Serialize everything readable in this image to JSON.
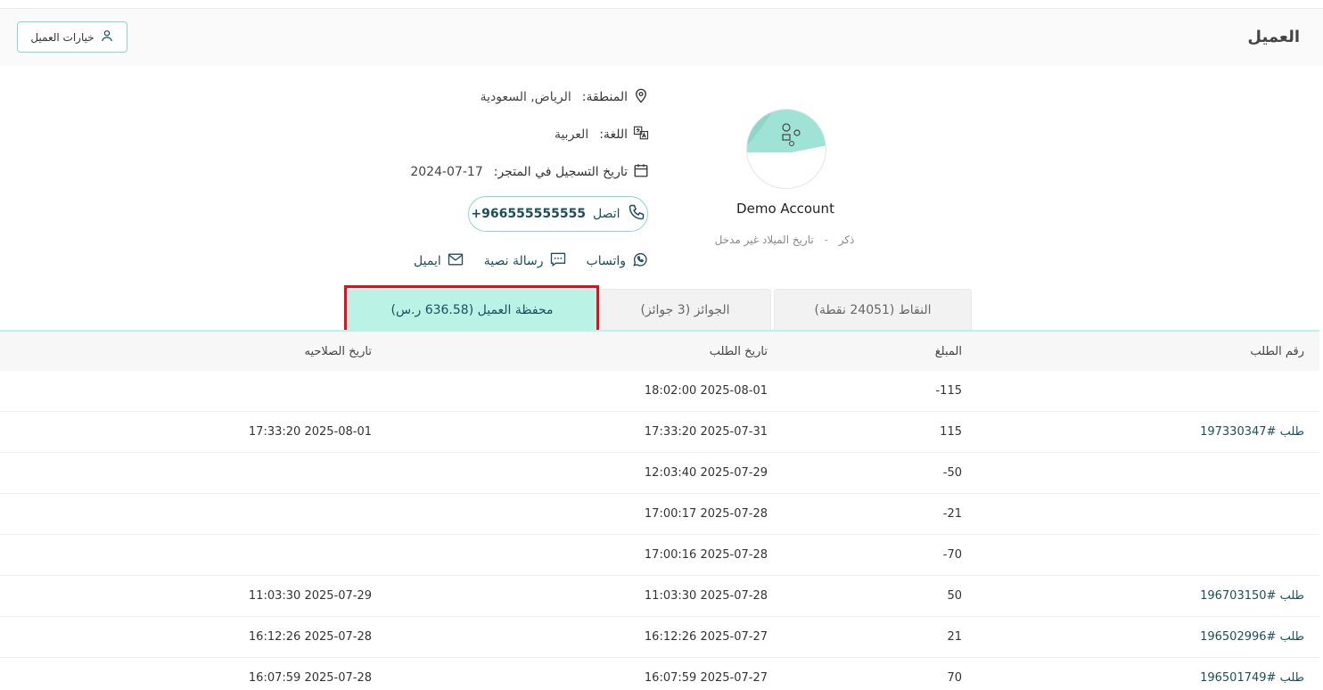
{
  "header": {
    "title": "العميل",
    "options_label": "خيارات العميل"
  },
  "profile": {
    "name": "Demo Account",
    "gender": "ذكر",
    "separator": "-",
    "birthdate": "تاريخ الميلاد غير مدخل"
  },
  "info": {
    "region_label": "المنطقة:",
    "region_value": "الرياض, السعودية",
    "language_label": "اللغة:",
    "language_value": "العربية",
    "registered_label": "تاريخ التسجيل في المتجر:",
    "registered_value": "2024-07-17",
    "call_label": "اتصل",
    "phone": "+966555555555",
    "whatsapp_label": "واتساب",
    "sms_label": "رسالة نصية",
    "email_label": "ايميل"
  },
  "tabs": [
    {
      "label": "النقاط (24051 نقطة)",
      "active": false
    },
    {
      "label": "الجوائز (3 جوائز)",
      "active": false
    },
    {
      "label": "محفظة العميل (636.58 ر.س)",
      "active": true
    }
  ],
  "table": {
    "columns": {
      "order": "رقم الطلب",
      "amount": "المبلغ",
      "date": "تاريخ الطلب",
      "expiry": "تاريخ الصلاحيه"
    },
    "rows": [
      {
        "order": "",
        "amount": "115-",
        "date": "2025-08-01 18:02:00",
        "expiry": ""
      },
      {
        "order": "طلب #197330347",
        "amount": "115",
        "date": "2025-07-31 17:33:20",
        "expiry": "2025-08-01 17:33:20"
      },
      {
        "order": "",
        "amount": "50-",
        "date": "2025-07-29 12:03:40",
        "expiry": ""
      },
      {
        "order": "",
        "amount": "21-",
        "date": "2025-07-28 17:00:17",
        "expiry": ""
      },
      {
        "order": "",
        "amount": "70-",
        "date": "2025-07-28 17:00:16",
        "expiry": ""
      },
      {
        "order": "طلب #196703150",
        "amount": "50",
        "date": "2025-07-28 11:03:30",
        "expiry": "2025-07-29 11:03:30"
      },
      {
        "order": "طلب #196502996",
        "amount": "21",
        "date": "2025-07-27 16:12:26",
        "expiry": "2025-07-28 16:12:26"
      },
      {
        "order": "طلب #196501749",
        "amount": "70",
        "date": "2025-07-27 16:07:59",
        "expiry": "2025-07-28 16:07:59"
      }
    ]
  },
  "colors": {
    "accent": "#baf3e6",
    "accent_border": "#86d9c8",
    "link": "#1c4d5c",
    "highlight": "#e0101b"
  }
}
